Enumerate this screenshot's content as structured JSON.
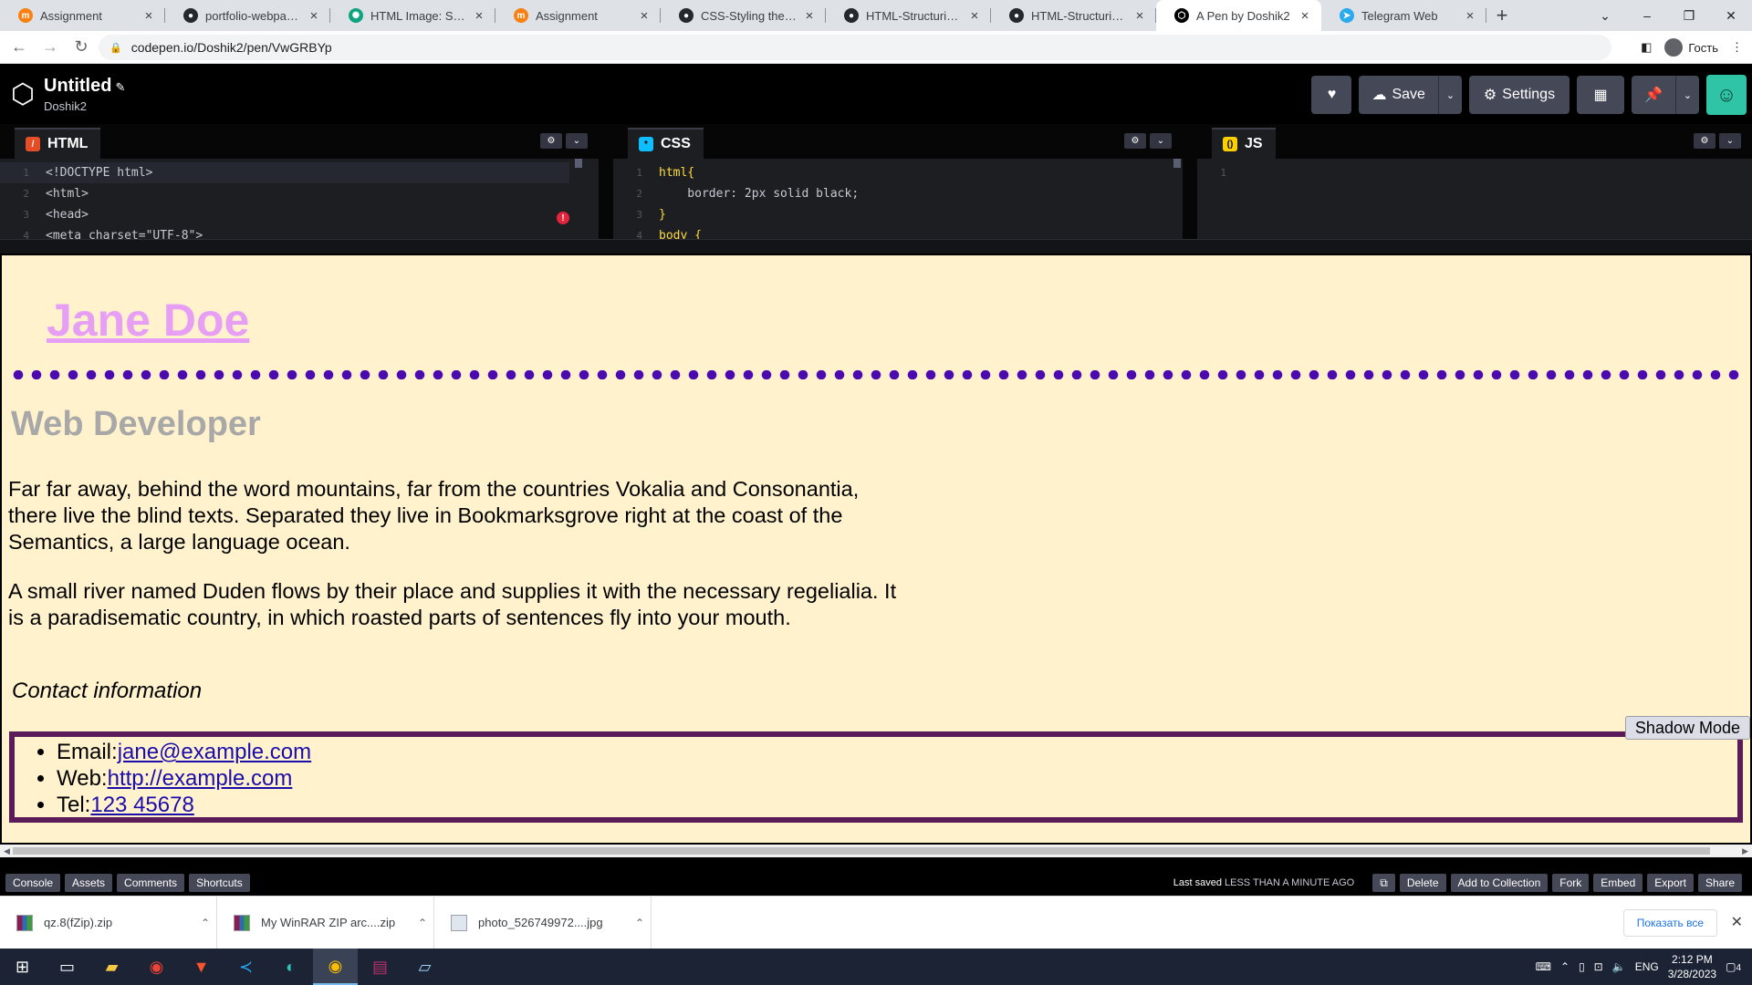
{
  "browser": {
    "tabs": [
      {
        "title": "Assignment",
        "icon": "moodle-icon",
        "color": "#f98012"
      },
      {
        "title": "portfolio-webpage/Cs",
        "icon": "github-icon",
        "color": "#24292e"
      },
      {
        "title": "HTML Image: Summar",
        "icon": "chatgpt-icon",
        "color": "#10a37f"
      },
      {
        "title": "Assignment",
        "icon": "moodle-icon",
        "color": "#f98012"
      },
      {
        "title": "CSS-Styling the web-P",
        "icon": "github-icon",
        "color": "#24292e"
      },
      {
        "title": "HTML-Structuring the",
        "icon": "github-icon",
        "color": "#24292e"
      },
      {
        "title": "HTML-Structuring the",
        "icon": "github-icon",
        "color": "#24292e"
      },
      {
        "title": "A Pen by Doshik2",
        "icon": "codepen-icon",
        "color": "#000000",
        "active": true
      },
      {
        "title": "Telegram Web",
        "icon": "telegram-icon",
        "color": "#2aabee"
      }
    ],
    "url": "codepen.io/Doshik2/pen/VwGRBYp",
    "profile_label": "Гость"
  },
  "codepen": {
    "title": "Untitled",
    "username": "Doshik2",
    "buttons": {
      "save": "Save",
      "settings": "Settings"
    },
    "editors": {
      "html": {
        "label": "HTML",
        "lines": [
          {
            "n": "1",
            "text": "<!DOCTYPE html>"
          },
          {
            "n": "2",
            "text": "<html>"
          },
          {
            "n": "3",
            "text": "<head>"
          },
          {
            "n": "4",
            "text": "<meta charset=\"UTF-8\">"
          }
        ]
      },
      "css": {
        "label": "CSS",
        "lines": [
          {
            "n": "1",
            "text": "html{"
          },
          {
            "n": "2",
            "text": "    border: 2px solid black;"
          },
          {
            "n": "3",
            "text": "}"
          },
          {
            "n": "4",
            "text": "body {"
          }
        ]
      },
      "js": {
        "label": "JS",
        "lines": [
          {
            "n": "1",
            "text": ""
          }
        ]
      }
    },
    "footer": {
      "left_buttons": [
        "Console",
        "Assets",
        "Comments",
        "Shortcuts"
      ],
      "last_saved_prefix": "Last saved",
      "last_saved_value": "LESS THAN A MINUTE AGO",
      "right_buttons": [
        "Delete",
        "Add to Collection",
        "Fork",
        "Embed",
        "Export",
        "Share"
      ]
    }
  },
  "preview": {
    "name": "Jane Doe",
    "role": "Web Developer",
    "paragraphs": [
      "Far far away, behind the word mountains, far from the countries Vokalia and Consonantia, there live the blind texts. Separated they live in Bookmarksgrove right at the coast of the Semantics, a large language ocean.",
      "A small river named Duden flows by their place and supplies it with the necessary regelialia. It is a paradisematic country, in which roasted parts of sentences fly into your mouth."
    ],
    "contact_heading": "Contact information",
    "shadow_mode": "Shadow Mode",
    "contacts": {
      "email_label": "Email:",
      "email": "jane@example.com",
      "web_label": "Web:",
      "web": "http://example.com",
      "tel_label": "Tel:",
      "tel": "123 45678"
    }
  },
  "downloads": {
    "items": [
      {
        "name": "qz.8(fZip).zip",
        "icon": "winrar-icon"
      },
      {
        "name": "My WinRAR ZIP arc....zip",
        "icon": "winrar-icon"
      },
      {
        "name": "photo_526749972....jpg",
        "icon": "image-file-icon"
      }
    ],
    "show_all": "Показать все"
  },
  "taskbar": {
    "lang": "ENG",
    "time": "2:12 PM",
    "date": "3/28/2023",
    "notifications": "4"
  }
}
